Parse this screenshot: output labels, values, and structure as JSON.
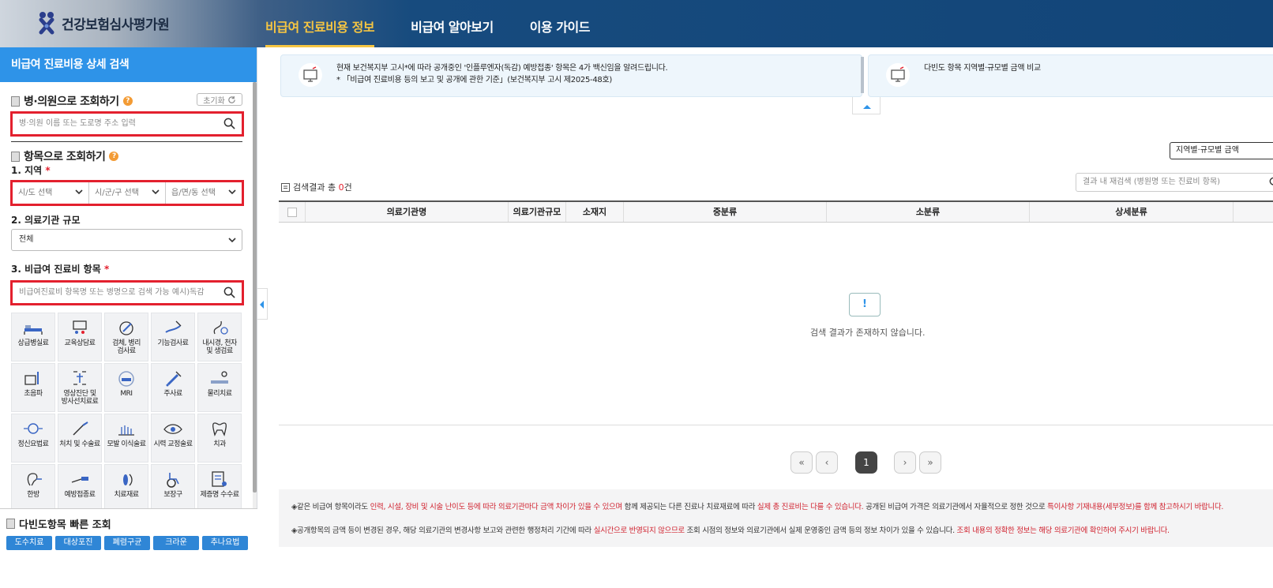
{
  "header": {
    "logo_text": "건강보험심사평가원",
    "nav": [
      "비급여 진료비용 정보",
      "비급여 알아보기",
      "이용 가이드"
    ]
  },
  "sidebar": {
    "title": "비급여 진료비용 상세 검색",
    "hospital": {
      "heading": "병·의원으로 조회하기",
      "reset_label": "초기화",
      "placeholder": "병·의원 이름 또는 도로명 주소 입력"
    },
    "item": {
      "heading": "항목으로 조회하기",
      "region_label": "1. 지역",
      "region_selects": [
        "시/도 선택",
        "시/군/구 선택",
        "읍/면/동 선택"
      ],
      "scale_label": "2. 의료기관 규모",
      "scale_value": "전체",
      "cost_label": "3. 비급여 진료비 항목",
      "required_mark": "*",
      "cost_placeholder": "비급여진료비 항목명 또는 병명으로 검색 가능 예시)독감"
    },
    "categories": [
      {
        "label": "상급병실료",
        "icon": "hospital-bed-icon"
      },
      {
        "label": "교육상담료",
        "icon": "consultation-icon"
      },
      {
        "label": "검체, 병리\n검사료",
        "icon": "microscope-icon"
      },
      {
        "label": "기능검사료",
        "icon": "function-test-icon"
      },
      {
        "label": "내시경, 천자\n및 생검료",
        "icon": "endoscope-icon"
      },
      {
        "label": "초음파",
        "icon": "ultrasound-icon"
      },
      {
        "label": "영상진단 및\n방사선치료료",
        "icon": "xray-icon"
      },
      {
        "label": "MRI",
        "icon": "mri-icon"
      },
      {
        "label": "주사료",
        "icon": "syringe-icon"
      },
      {
        "label": "물리치료",
        "icon": "physical-therapy-icon"
      },
      {
        "label": "정신요법료",
        "icon": "brain-icon"
      },
      {
        "label": "처치 및 수술료",
        "icon": "scalpel-icon"
      },
      {
        "label": "모발 이식술료",
        "icon": "hair-transplant-icon"
      },
      {
        "label": "시력 교정술료",
        "icon": "eye-icon"
      },
      {
        "label": "치과",
        "icon": "tooth-icon"
      },
      {
        "label": "한방",
        "icon": "ear-acupuncture-icon"
      },
      {
        "label": "예방접종료",
        "icon": "vaccine-icon"
      },
      {
        "label": "치료재료",
        "icon": "implant-icon"
      },
      {
        "label": "보장구",
        "icon": "wheelchair-icon"
      },
      {
        "label": "제증명 수수료",
        "icon": "certificate-icon"
      }
    ],
    "quick": {
      "heading": "다빈도항목 빠른 조회",
      "buttons": [
        "도수치료",
        "대상포진",
        "폐렴구균",
        "크라운",
        "추나요법"
      ]
    }
  },
  "notices": [
    {
      "line1": "현재 보건복지부 고시*에 따라 공개중인 '인플루엔자(독감) 예방접종' 항목은 4가 백신임을 알려드립니다.",
      "line2": "* 「비급여 진료비용 등의 보고 및 공개에 관한 기준」(보건복지부 고시 제2025-48호)"
    },
    {
      "line1": "다빈도 항목 지역별·규모별 금액 비교",
      "line2": ""
    }
  ],
  "results": {
    "compare_button": "지역별·규모별 금액",
    "count_prefix": "검색결과 총 ",
    "count_value": "0",
    "count_suffix": "건",
    "re_search_placeholder": "결과 내 재검색 (병원명 또는 진료비 항목)",
    "columns": [
      "",
      "의료기관명",
      "의료기관규모",
      "소재지",
      "중분류",
      "소분류",
      "상세분류"
    ],
    "empty_message": "검색 결과가 존재하지 않습니다.",
    "empty_icon": "!"
  },
  "pagination": {
    "first": "«",
    "prev": "‹",
    "current": "1",
    "next": "›",
    "last": "»"
  },
  "footnotes": [
    {
      "bullet": "◈",
      "parts": [
        {
          "t": "같은 비급여 항목이라도 ",
          "red": false
        },
        {
          "t": "인력, 시설, 장비 및 시술 난이도 등에 따라 의료기관마다 금액 차이가 있을 수 있으며",
          "red": true
        },
        {
          "t": " 함께 제공되는 다른 진료나 치료재료에 따라 ",
          "red": false
        },
        {
          "t": "실제 총 진료비는 다를 수 있습니다.",
          "red": true
        },
        {
          "t": " 공개된 비급여 가격은 의료기관에서 자율적으로 정한 것으로 ",
          "red": false
        },
        {
          "t": "특이사항 기재내용(세부정보)를 함께 참고하시기 바랍니다.",
          "red": true
        }
      ]
    },
    {
      "bullet": "◈",
      "parts": [
        {
          "t": "공개항목의 금액 등이 변경된 경우, 해당 의료기관의 변경사항 보고와 관련한 행정처리 기간에 따라 ",
          "red": false
        },
        {
          "t": "실시간으로 반영되지 않으므로",
          "red": true
        },
        {
          "t": " 조회 시점의 정보와 의료기관에서 실제 운영중인 금액 등의 정보 차이가 있을 수 있습니다. ",
          "red": false
        },
        {
          "t": "조회 내용의 정확한 정보는 해당 의료기관에 확인하여 주시기 바랍니다.",
          "red": true
        }
      ]
    }
  ],
  "colors": {
    "accent": "#2e93e8",
    "nav_active": "#f5c542",
    "highlight_border": "#e3202e",
    "header_bg": "#124578"
  }
}
